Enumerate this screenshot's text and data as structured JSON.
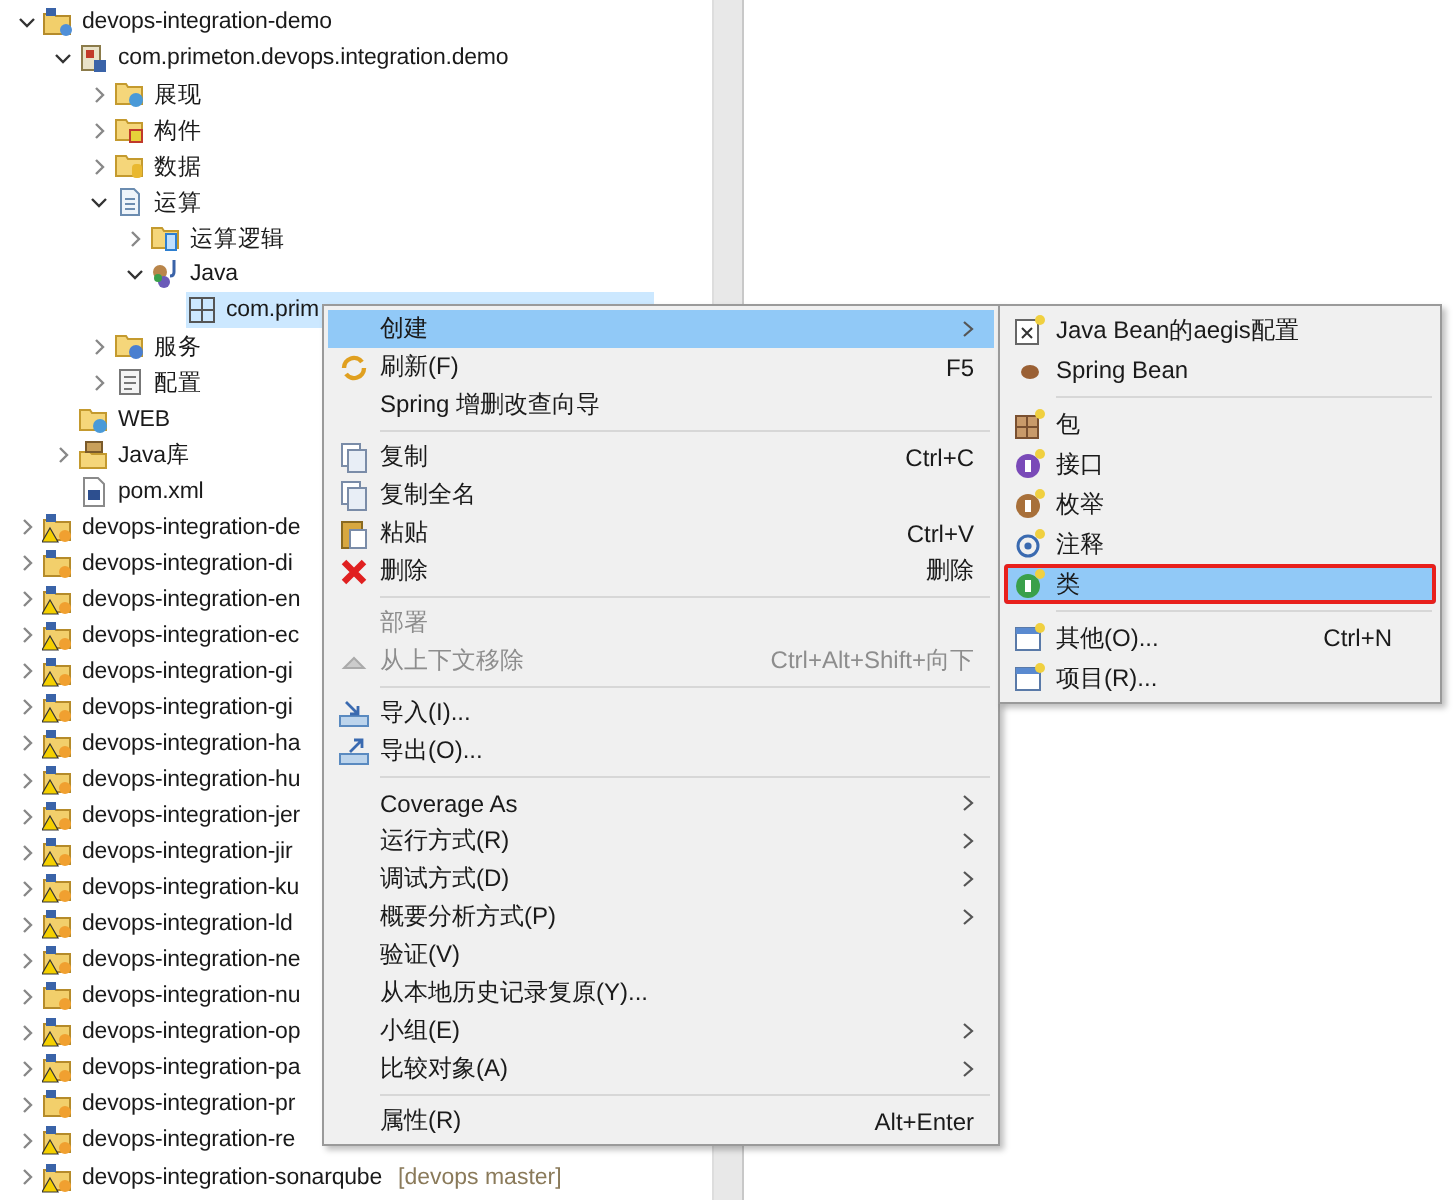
{
  "tree": [
    {
      "label": "devops-integration-demo",
      "kind": "project",
      "expanded": true,
      "selected": false,
      "children": [
        {
          "label": "com.primeton.devops.integration.demo",
          "kind": "module",
          "expanded": true,
          "selected": false,
          "children": [
            {
              "label": "展现",
              "kind": "folder-globe",
              "expanded": false,
              "selected": false
            },
            {
              "label": "构件",
              "kind": "folder-red",
              "expanded": false,
              "selected": false
            },
            {
              "label": "数据",
              "kind": "folder-db",
              "expanded": false,
              "selected": false
            },
            {
              "label": "运算",
              "kind": "logic",
              "expanded": true,
              "selected": false,
              "children": [
                {
                  "label": "运算逻辑",
                  "kind": "folder-blue",
                  "expanded": false,
                  "selected": false
                },
                {
                  "label": "Java",
                  "kind": "java",
                  "expanded": true,
                  "selected": false,
                  "children": [
                    {
                      "label": "com.prim",
                      "kind": "package",
                      "selected": true
                    }
                  ]
                }
              ]
            },
            {
              "label": "服务",
              "kind": "folder-service",
              "expanded": false,
              "selected": false
            },
            {
              "label": "配置",
              "kind": "config",
              "expanded": false,
              "selected": false
            }
          ]
        },
        {
          "label": "WEB",
          "kind": "folder-globe",
          "selected": false
        },
        {
          "label": "Java库",
          "kind": "library",
          "expanded": false,
          "selected": false
        },
        {
          "label": "pom.xml",
          "kind": "pom",
          "selected": false
        }
      ]
    },
    {
      "label": "devops-integration-de",
      "kind": "warn-project",
      "expanded": false,
      "selected": false
    },
    {
      "label": "devops-integration-di",
      "kind": "plain-project",
      "expanded": false,
      "selected": false
    },
    {
      "label": "devops-integration-en",
      "kind": "warn-project",
      "expanded": false,
      "selected": false
    },
    {
      "label": "devops-integration-ec",
      "kind": "warn-project",
      "expanded": false,
      "selected": false
    },
    {
      "label": "devops-integration-gi",
      "kind": "warn-project",
      "expanded": false,
      "selected": false
    },
    {
      "label": "devops-integration-gi",
      "kind": "warn-project",
      "expanded": false,
      "selected": false
    },
    {
      "label": "devops-integration-ha",
      "kind": "warn-project",
      "expanded": false,
      "selected": false
    },
    {
      "label": "devops-integration-hu",
      "kind": "warn-project",
      "expanded": false,
      "selected": false
    },
    {
      "label": "devops-integration-jer",
      "kind": "warn-project",
      "expanded": false,
      "selected": false
    },
    {
      "label": "devops-integration-jir",
      "kind": "warn-project",
      "expanded": false,
      "selected": false
    },
    {
      "label": "devops-integration-ku",
      "kind": "warn-project",
      "expanded": false,
      "selected": false
    },
    {
      "label": "devops-integration-ld",
      "kind": "warn-project",
      "expanded": false,
      "selected": false
    },
    {
      "label": "devops-integration-ne",
      "kind": "warn-project",
      "expanded": false,
      "selected": false
    },
    {
      "label": "devops-integration-nu",
      "kind": "plain-project",
      "expanded": false,
      "selected": false
    },
    {
      "label": "devops-integration-op",
      "kind": "warn-project",
      "expanded": false,
      "selected": false
    },
    {
      "label": "devops-integration-pa",
      "kind": "warn-project",
      "expanded": false,
      "selected": false
    },
    {
      "label": "devops-integration-pr",
      "kind": "plain-project",
      "expanded": false,
      "selected": false
    },
    {
      "label": "devops-integration-re",
      "kind": "warn-project",
      "expanded": false,
      "selected": false
    },
    {
      "label": "devops-integration-sonarqube",
      "decoration": "[devops master]",
      "kind": "warn-project",
      "expanded": false,
      "selected": false
    }
  ],
  "context_menu": {
    "groups": [
      [
        {
          "label": "创建",
          "submenu": true,
          "selected": true,
          "disabled": false
        },
        {
          "label": "刷新(F)",
          "shortcut": "F5",
          "submenu": false,
          "selected": false,
          "disabled": false
        },
        {
          "label": "Spring 增删改查向导",
          "submenu": false,
          "selected": false,
          "disabled": false
        }
      ],
      [
        {
          "label": "复制",
          "shortcut": "Ctrl+C",
          "submenu": false,
          "selected": false,
          "disabled": false
        },
        {
          "label": "复制全名",
          "submenu": false,
          "selected": false,
          "disabled": false
        },
        {
          "label": "粘贴",
          "shortcut": "Ctrl+V",
          "submenu": false,
          "selected": false,
          "disabled": false
        },
        {
          "label": "删除",
          "shortcut": "删除",
          "submenu": false,
          "selected": false,
          "disabled": false
        }
      ],
      [
        {
          "label": "部署",
          "submenu": false,
          "selected": false,
          "disabled": true
        },
        {
          "label": "从上下文移除",
          "shortcut": "Ctrl+Alt+Shift+向下",
          "submenu": false,
          "selected": false,
          "disabled": true
        }
      ],
      [
        {
          "label": "导入(I)...",
          "submenu": false,
          "selected": false,
          "disabled": false
        },
        {
          "label": "导出(O)...",
          "submenu": false,
          "selected": false,
          "disabled": false
        }
      ],
      [
        {
          "label": "Coverage As",
          "submenu": true,
          "selected": false,
          "disabled": false
        },
        {
          "label": "运行方式(R)",
          "submenu": true,
          "selected": false,
          "disabled": false
        },
        {
          "label": "调试方式(D)",
          "submenu": true,
          "selected": false,
          "disabled": false
        },
        {
          "label": "概要分析方式(P)",
          "submenu": true,
          "selected": false,
          "disabled": false
        },
        {
          "label": "验证(V)",
          "submenu": false,
          "selected": false,
          "disabled": false
        },
        {
          "label": "从本地历史记录复原(Y)...",
          "submenu": false,
          "selected": false,
          "disabled": false
        },
        {
          "label": "小组(E)",
          "submenu": true,
          "selected": false,
          "disabled": false
        },
        {
          "label": "比较对象(A)",
          "submenu": true,
          "selected": false,
          "disabled": false
        }
      ],
      [
        {
          "label": "属性(R)",
          "shortcut": "Alt+Enter",
          "submenu": false,
          "selected": false,
          "disabled": false
        }
      ]
    ]
  },
  "submenu": {
    "groups": [
      [
        {
          "label": "Java Bean的aegis配置",
          "selected": false,
          "outlined": false
        },
        {
          "label": "Spring Bean",
          "selected": false,
          "outlined": false
        }
      ],
      [
        {
          "label": "包",
          "selected": false,
          "outlined": false
        },
        {
          "label": "接口",
          "selected": false,
          "outlined": false
        },
        {
          "label": "枚举",
          "selected": false,
          "outlined": false
        },
        {
          "label": "注释",
          "selected": false,
          "outlined": false
        },
        {
          "label": "类",
          "selected": true,
          "outlined": true
        }
      ],
      [
        {
          "label": "其他(O)...",
          "shortcut": "Ctrl+N",
          "selected": false,
          "outlined": false
        },
        {
          "label": "项目(R)...",
          "selected": false,
          "outlined": false
        }
      ]
    ]
  }
}
